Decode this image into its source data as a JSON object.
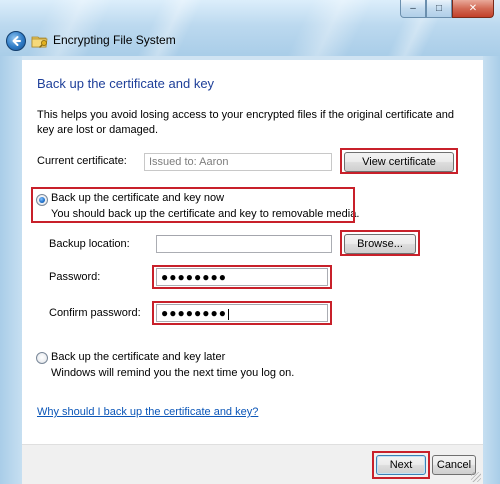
{
  "window": {
    "title": "Encrypting File System",
    "controls": {
      "minimize": "–",
      "maximize": "□",
      "close": "✕"
    }
  },
  "page": {
    "heading": "Back up the certificate and key",
    "intro_line1": "This helps you avoid losing access to your encrypted files if the original certificate and",
    "intro_line2": "key are lost or damaged."
  },
  "current_certificate": {
    "label": "Current certificate:",
    "value": "Issued to: Aaron",
    "view_button": "View certificate"
  },
  "backup_now": {
    "label": "Back up the certificate and key now",
    "description": "You should back up the certificate and key to removable media.",
    "selected": true
  },
  "backup_location": {
    "label": "Backup location:",
    "value": "",
    "browse_button": "Browse..."
  },
  "password": {
    "label": "Password:",
    "value": "●●●●●●●●"
  },
  "confirm_password": {
    "label": "Confirm password:",
    "value": "●●●●●●●●"
  },
  "backup_later": {
    "label": "Back up the certificate and key later",
    "description": "Windows will remind you the next time you log on.",
    "selected": false
  },
  "help_link": "Why should I back up the certificate and key?",
  "footer": {
    "next_button": "Next",
    "cancel_button": "Cancel"
  },
  "colors": {
    "heading": "#1e3f99",
    "link": "#0b56b8",
    "highlight": "#c8202a"
  }
}
